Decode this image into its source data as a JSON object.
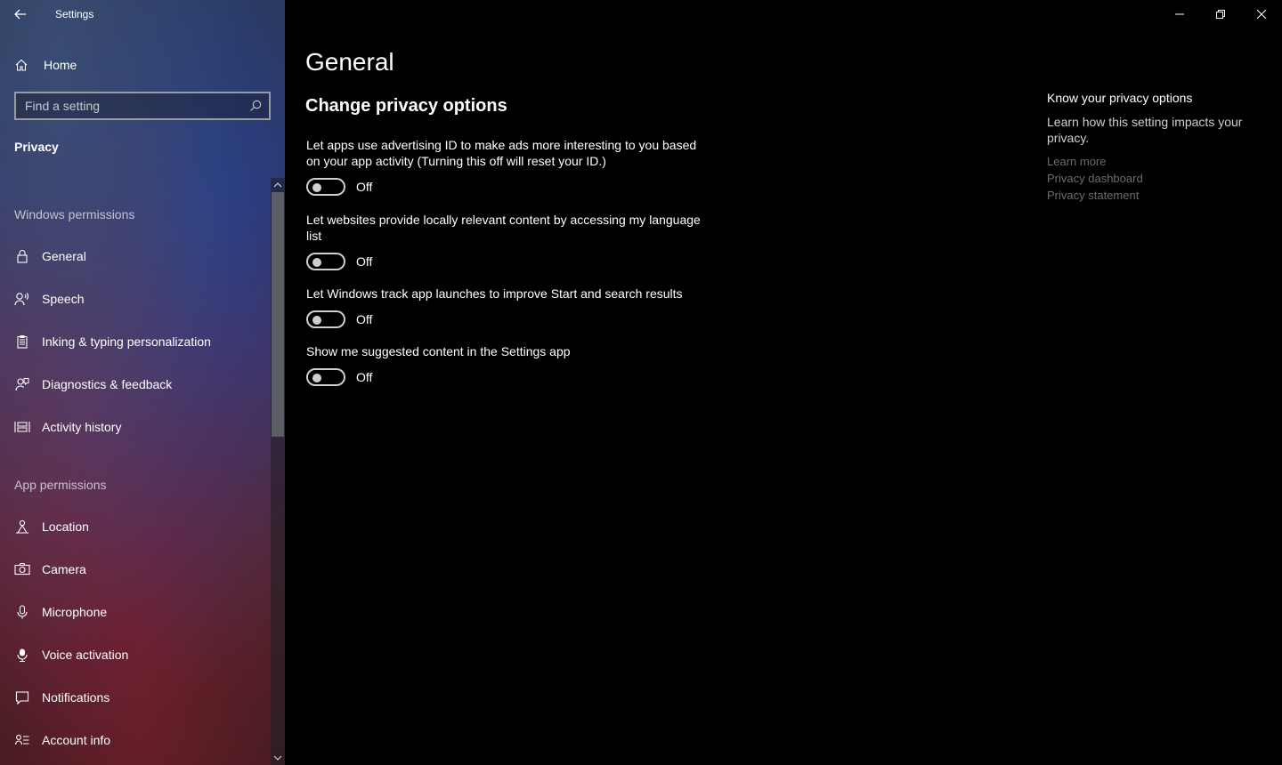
{
  "window": {
    "title": "Settings",
    "controls": [
      "minimize-icon",
      "restore-icon",
      "close-icon"
    ]
  },
  "sidebar": {
    "home_label": "Home",
    "search_placeholder": "Find a setting",
    "section_title": "Privacy",
    "groups": [
      {
        "header": "Windows permissions",
        "items": [
          {
            "label": "General",
            "icon": "lock-icon",
            "selected": true
          },
          {
            "label": "Speech",
            "icon": "speech-icon"
          },
          {
            "label": "Inking & typing personalization",
            "icon": "clipboard-icon"
          },
          {
            "label": "Diagnostics & feedback",
            "icon": "feedback-icon"
          },
          {
            "label": "Activity history",
            "icon": "timeline-icon"
          }
        ]
      },
      {
        "header": "App permissions",
        "items": [
          {
            "label": "Location",
            "icon": "location-icon"
          },
          {
            "label": "Camera",
            "icon": "camera-icon"
          },
          {
            "label": "Microphone",
            "icon": "microphone-icon"
          },
          {
            "label": "Voice activation",
            "icon": "voice-activation-icon"
          },
          {
            "label": "Notifications",
            "icon": "notification-icon"
          },
          {
            "label": "Account info",
            "icon": "account-info-icon"
          }
        ]
      }
    ]
  },
  "main": {
    "title": "General",
    "subtitle": "Change privacy options",
    "settings": [
      {
        "description": "Let apps use advertising ID to make ads more interesting to you based on your app activity (Turning this off will reset your ID.)",
        "state": "Off"
      },
      {
        "description": "Let websites provide locally relevant content by accessing my language list",
        "state": "Off"
      },
      {
        "description": "Let Windows track app launches to improve Start and search results",
        "state": "Off"
      },
      {
        "description": "Show me suggested content in the Settings app",
        "state": "Off"
      }
    ]
  },
  "aside": {
    "title": "Know your privacy options",
    "description": "Learn how this setting impacts your privacy.",
    "links": [
      "Learn more",
      "Privacy dashboard",
      "Privacy statement"
    ]
  }
}
